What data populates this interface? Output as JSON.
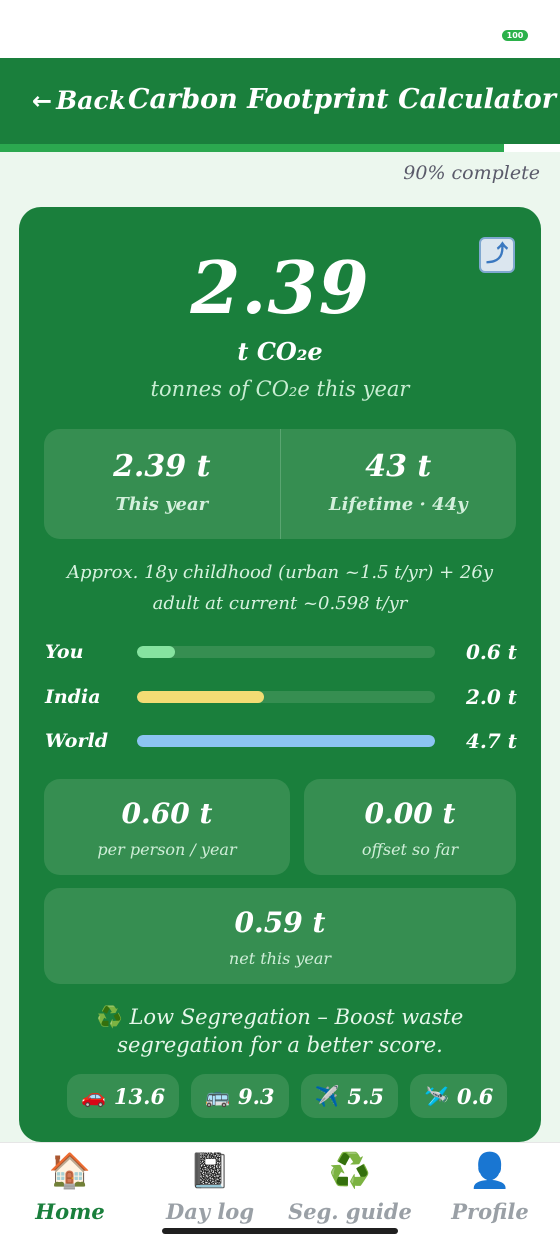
{
  "status_bar": {
    "battery": "100"
  },
  "header": {
    "back_label": "Back",
    "back_icon": "arrow-left-icon",
    "title": "Carbon Footprint Calculator"
  },
  "progress": {
    "percent": 90,
    "text": "90% complete"
  },
  "summary": {
    "value": "2.39",
    "unit": "t CO₂e",
    "caption": "tonnes of CO₂e this year",
    "share_icon": "share-arrow-icon"
  },
  "stats": [
    {
      "value": "2.39 t",
      "label": "This year"
    },
    {
      "value": "43 t",
      "label": "Lifetime · 44y"
    }
  ],
  "approx_note": "Approx. 18y childhood (urban ~1.5 t/yr) + 26y adult at current ~0.598 t/yr",
  "comparison": [
    {
      "label": "You",
      "value": "0.6 t",
      "level": 0.6,
      "max": 4.7,
      "color": "#86e3a0"
    },
    {
      "label": "India",
      "value": "2.0 t",
      "level": 2.0,
      "max": 4.7,
      "color": "#f3dc74"
    },
    {
      "label": "World",
      "value": "4.7 t",
      "level": 4.7,
      "max": 4.7,
      "color": "#8cc4f2"
    }
  ],
  "metrics": {
    "per_person": {
      "value": "0.60 t",
      "label": "per person / year"
    },
    "offset": {
      "value": "0.00 t",
      "label": "offset so far"
    },
    "net": {
      "value": "0.59 t",
      "label": "net this year"
    }
  },
  "segregation": {
    "icon": "recycle-icon",
    "text": "Low Segregation – Boost waste segregation for a better score."
  },
  "chips": [
    {
      "icon": "car-icon",
      "value": "13.6"
    },
    {
      "icon": "bus-icon",
      "value": "9.3"
    },
    {
      "icon": "airplane-icon",
      "value": "5.5"
    },
    {
      "icon": "airplane-small-icon",
      "value": "0.6"
    }
  ],
  "nav": [
    {
      "label": "Home",
      "icon": "house-icon",
      "active": true
    },
    {
      "label": "Day log",
      "icon": "notebook-icon",
      "active": false
    },
    {
      "label": "Seg. guide",
      "icon": "recycle-icon",
      "active": false
    },
    {
      "label": "Profile",
      "icon": "person-icon",
      "active": false
    }
  ],
  "colors": {
    "primary": "#1a7f3c",
    "card_inner": "#368e51",
    "accent": "#2ba84f"
  }
}
